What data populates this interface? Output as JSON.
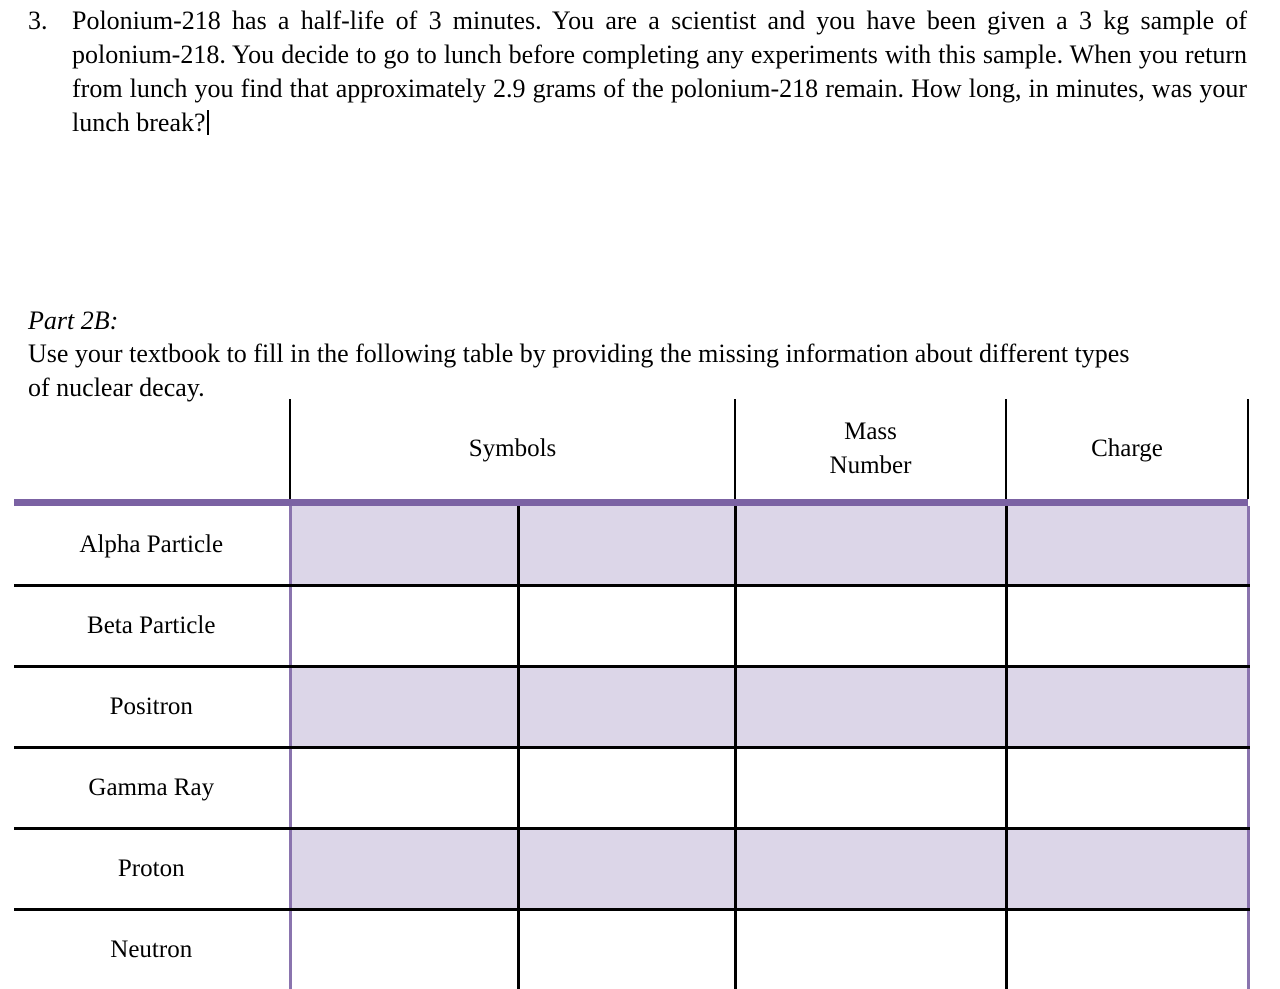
{
  "question": {
    "number": "3.",
    "line1": "Polonium-218 has a half-life of 3 minutes.  You are a scientist and you have been given a 3 kg",
    "line2": "sample of polonium-218.  You decide to go to lunch before completing any experiments with",
    "line3": "this sample.   When you return from lunch you find that approximately 2.9 grams of the",
    "line4": "polonium-218 remain.  How long, in minutes, was your lunch break?",
    "full_text": "Polonium-218 has a half-life of 3 minutes.  You are a scientist and you have been given a 3 kg sample of polonium-218.  You decide to go to lunch before completing any experiments with this sample.   When you return from lunch you find that approximately 2.9 grams of the polonium-218 remain.  How long, in minutes, was your lunch break?"
  },
  "part2b": {
    "heading": "Part 2B:",
    "instructions": "Use your textbook to fill in the following table by providing the missing information about different types of nuclear decay."
  },
  "table": {
    "headers": {
      "blank": "",
      "symbols": "Symbols",
      "mass_number_line1": "Mass",
      "mass_number_line2": "Number",
      "charge": "Charge"
    },
    "rows": [
      {
        "label": "Alpha Particle",
        "symbol_a": "",
        "symbol_b": "",
        "mass_number": "",
        "charge": ""
      },
      {
        "label": "Beta Particle",
        "symbol_a": "",
        "symbol_b": "",
        "mass_number": "",
        "charge": ""
      },
      {
        "label": "Positron",
        "symbol_a": "",
        "symbol_b": "",
        "mass_number": "",
        "charge": ""
      },
      {
        "label": "Gamma Ray",
        "symbol_a": "",
        "symbol_b": "",
        "mass_number": "",
        "charge": ""
      },
      {
        "label": "Proton",
        "symbol_a": "",
        "symbol_b": "",
        "mass_number": "",
        "charge": ""
      },
      {
        "label": "Neutron",
        "symbol_a": "",
        "symbol_b": "",
        "mass_number": "",
        "charge": ""
      }
    ],
    "colors": {
      "rule": "#7B62A3",
      "shaded_fill": "#DCD6E8",
      "grid_black": "#000000",
      "grid_purple": "#8A74AE"
    }
  }
}
